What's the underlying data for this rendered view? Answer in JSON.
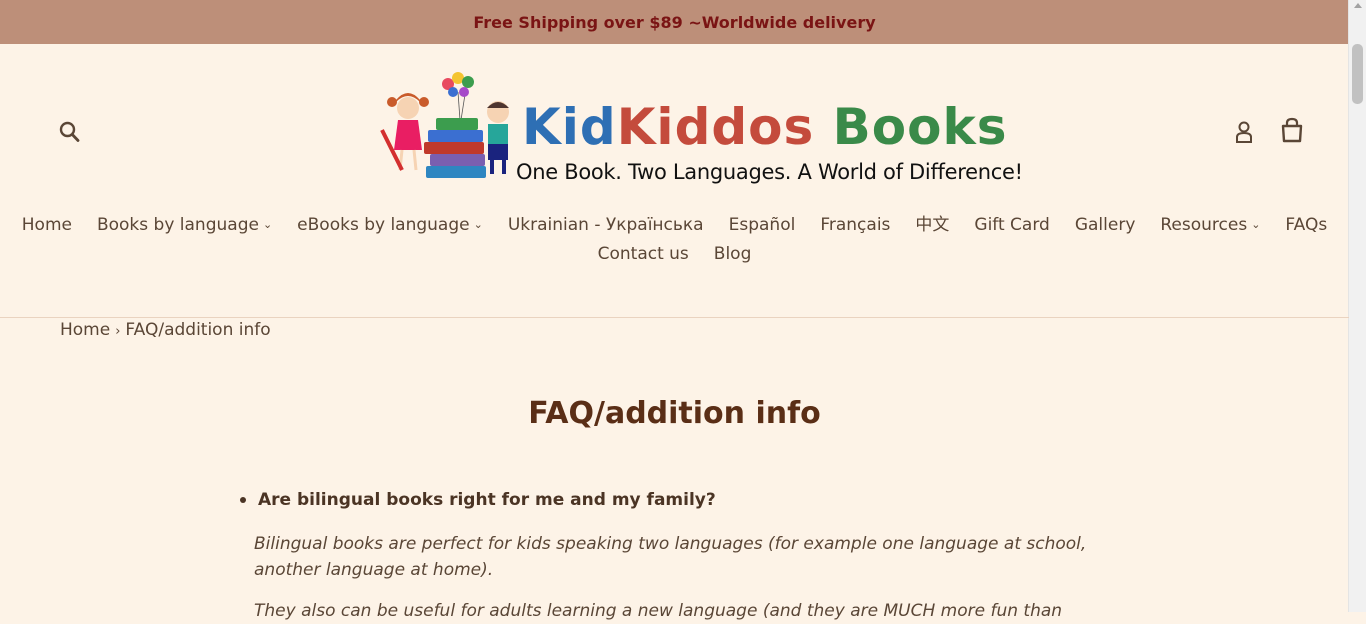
{
  "announcement": "Free Shipping over $89 ~Worldwide delivery",
  "logo": {
    "title_part1": "Kid",
    "title_part2": "Kiddos",
    "title_part3": " Books",
    "tagline": "One Book. Two Languages. A World of Difference!"
  },
  "header_icons": {
    "search": "search-icon",
    "login": "user-icon",
    "login_label": "Log in",
    "cart": "cart-icon",
    "cart_label": "Cart"
  },
  "nav": {
    "row1": [
      {
        "label": "Home",
        "dropdown": false
      },
      {
        "label": "Books by language",
        "dropdown": true
      },
      {
        "label": "eBooks by language",
        "dropdown": true
      },
      {
        "label": "Ukrainian - Українська",
        "dropdown": false
      },
      {
        "label": "Español",
        "dropdown": false
      },
      {
        "label": "Français",
        "dropdown": false
      },
      {
        "label": "中文",
        "dropdown": false
      },
      {
        "label": "Gift Card",
        "dropdown": false
      },
      {
        "label": "Gallery",
        "dropdown": false
      },
      {
        "label": "Resources",
        "dropdown": true
      },
      {
        "label": "FAQs",
        "dropdown": false
      }
    ],
    "row2": [
      {
        "label": "Contact us",
        "dropdown": false
      },
      {
        "label": "Blog",
        "dropdown": false
      }
    ]
  },
  "breadcrumb": {
    "home": "Home",
    "separator": "›",
    "current": "FAQ/addition info"
  },
  "page": {
    "title": "FAQ/addition info",
    "question1": "Are bilingual books right for me and my family?",
    "answer1": "Bilingual books are perfect for kids speaking two languages (for example one language at school, another language at home).",
    "answer2_partial": "They also can be useful for adults learning a new language (and they are MUCH more fun than"
  },
  "colors": {
    "announcement_bg": "#bd8f79",
    "announcement_text": "#7a1414",
    "page_bg": "#fdf3e7",
    "text": "#5a4636",
    "title": "#5a2e16"
  }
}
